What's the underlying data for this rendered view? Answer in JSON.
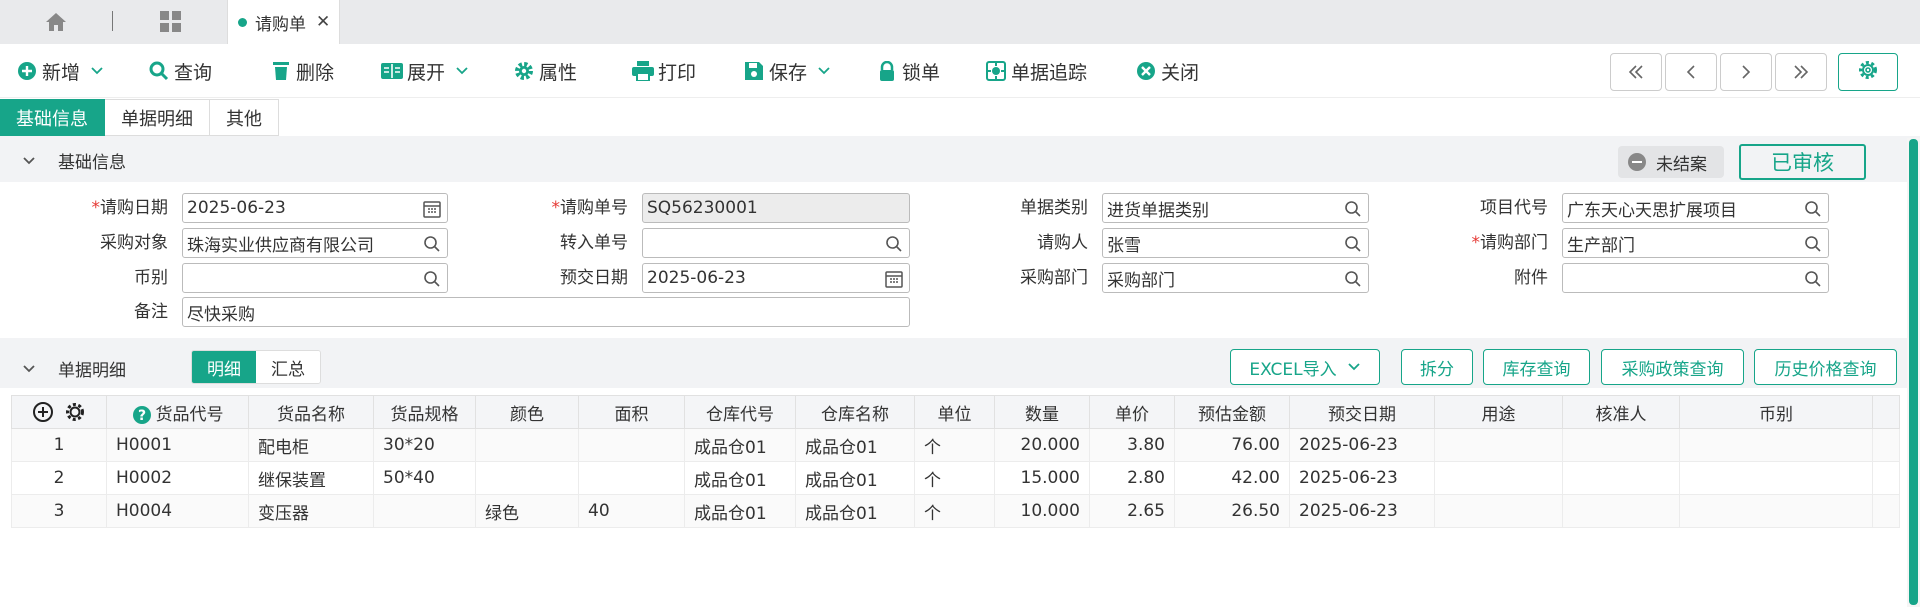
{
  "tabbar": {
    "active_tab": "请购单"
  },
  "toolbar": {
    "new": "新增",
    "query": "查询",
    "delete": "删除",
    "expand": "展开",
    "props": "属性",
    "print": "打印",
    "save": "保存",
    "lock": "锁单",
    "trace": "单据追踪",
    "close": "关闭"
  },
  "subtabs": [
    "基础信息",
    "单据明细",
    "其他"
  ],
  "basic": {
    "section": "基础信息",
    "status_unclosed": "未结案",
    "status_audited": "已审核"
  },
  "form": {
    "req_date": {
      "label": "请购日期",
      "value": "2025-06-23"
    },
    "req_no": {
      "label": "请购单号",
      "value": "SQ56230001"
    },
    "doc_type": {
      "label": "单据类别",
      "value": "进货单据类别"
    },
    "project": {
      "label": "项目代号",
      "value": "广东天心天思扩展项目"
    },
    "target": {
      "label": "采购对象",
      "value": "珠海实业供应商有限公司"
    },
    "transfer_no": {
      "label": "转入单号",
      "value": ""
    },
    "requester": {
      "label": "请购人",
      "value": "张雪"
    },
    "req_dept": {
      "label": "请购部门",
      "value": "生产部门"
    },
    "currency": {
      "label": "币别",
      "value": ""
    },
    "delivery_date": {
      "label": "预交日期",
      "value": "2025-06-23"
    },
    "buy_dept": {
      "label": "采购部门",
      "value": "采购部门"
    },
    "attachment": {
      "label": "附件",
      "value": ""
    },
    "remark": {
      "label": "备注",
      "value": "尽快采购"
    }
  },
  "detail": {
    "section": "单据明细",
    "seg_detail": "明细",
    "seg_summary": "汇总",
    "btn_excel": "EXCEL导入",
    "btn_split": "拆分",
    "btn_stock": "库存查询",
    "btn_policy": "采购政策查询",
    "btn_history": "历史价格查询"
  },
  "table": {
    "headers": [
      "货品代号",
      "货品名称",
      "货品规格",
      "颜色",
      "面积",
      "仓库代号",
      "仓库名称",
      "单位",
      "数量",
      "单价",
      "预估金额",
      "预交日期",
      "用途",
      "核准人",
      "币别"
    ],
    "rows": [
      [
        "1",
        "H0001",
        "配电柜",
        "30*20",
        "",
        "",
        "成品仓01",
        "成品仓01",
        "个",
        "20.000",
        "3.80",
        "76.00",
        "2025-06-23",
        "",
        "",
        ""
      ],
      [
        "2",
        "H0002",
        "继保装置",
        "50*40",
        "",
        "",
        "成品仓01",
        "成品仓01",
        "个",
        "15.000",
        "2.80",
        "42.00",
        "2025-06-23",
        "",
        "",
        ""
      ],
      [
        "3",
        "H0004",
        "变压器",
        "",
        "绿色",
        "40",
        "成品仓01",
        "成品仓01",
        "个",
        "10.000",
        "2.65",
        "26.50",
        "2025-06-23",
        "",
        "",
        ""
      ]
    ]
  },
  "colors": {
    "accent": "#17a589",
    "required": "#e53935"
  }
}
